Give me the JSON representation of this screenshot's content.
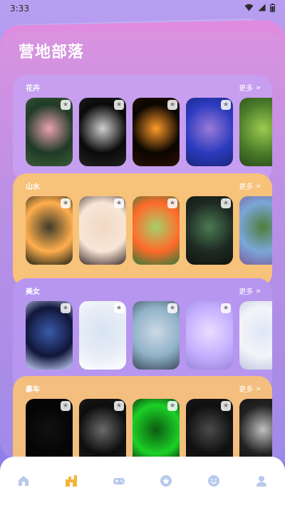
{
  "status_bar": {
    "time": "3:33"
  },
  "page_title": "营地部落",
  "more_label": "更多",
  "more_arrow": "»",
  "sections": [
    {
      "title": "花卉",
      "thumbs": [
        {
          "name": "pink-roses",
          "colors": [
            "#1f3a26",
            "#e9a1b1",
            "#3c5c34"
          ]
        },
        {
          "name": "white-rose",
          "colors": [
            "#0a0a0a",
            "#cfcfcf",
            "#222222"
          ]
        },
        {
          "name": "golden-light",
          "colors": [
            "#0b0501",
            "#ff9a2a",
            "#2a1202"
          ]
        },
        {
          "name": "blue-kaleidoscope",
          "colors": [
            "#2b3bbf",
            "#9b7ad8",
            "#1d257a"
          ]
        },
        {
          "name": "pine-branch",
          "colors": [
            "#4b7c2a",
            "#9ccc4e",
            "#2b4a18"
          ]
        }
      ]
    },
    {
      "title": "山水",
      "thumbs": [
        {
          "name": "sunset-forest",
          "colors": [
            "#ffae4d",
            "#3e3c2a",
            "#1b1f16"
          ]
        },
        {
          "name": "winter-cabin",
          "colors": [
            "#f7e6d6",
            "#f2d8c4",
            "#3f2a2a"
          ]
        },
        {
          "name": "autumn-river",
          "colors": [
            "#ff6a2a",
            "#a7d06b",
            "#2f7c3b"
          ]
        },
        {
          "name": "fern-leaves",
          "colors": [
            "#1e2a23",
            "#4a7a52",
            "#101510"
          ]
        },
        {
          "name": "hills-path",
          "colors": [
            "#7aa6d8",
            "#4f7d3a",
            "#7a5f9c"
          ]
        }
      ]
    },
    {
      "title": "美女",
      "thumbs": [
        {
          "name": "dark-cosplay",
          "colors": [
            "#11163a",
            "#3a5aa8",
            "#c9d6ff"
          ]
        },
        {
          "name": "white-dress",
          "colors": [
            "#e7edf7",
            "#d8e3f2",
            "#ffffff"
          ]
        },
        {
          "name": "beach-girl",
          "colors": [
            "#8fb1c8",
            "#cdd9e6",
            "#3d4a58"
          ]
        },
        {
          "name": "purple-girl",
          "colors": [
            "#c4b0ff",
            "#e8ddff",
            "#9a84d8"
          ]
        },
        {
          "name": "white-cosplay",
          "colors": [
            "#f4f4f8",
            "#dde7f7",
            "#bcc8e0"
          ]
        }
      ]
    },
    {
      "title": "豪车",
      "thumbs": [
        {
          "name": "dark-car",
          "colors": [
            "#050505",
            "#111111",
            "#050505"
          ]
        },
        {
          "name": "silver-car",
          "colors": [
            "#0d0d0d",
            "#6a6a6a",
            "#1e1e1e"
          ]
        },
        {
          "name": "green-car",
          "colors": [
            "#1bd126",
            "#0d5a12",
            "#0c0c0c"
          ]
        },
        {
          "name": "mercedes-car",
          "colors": [
            "#0f0f0f",
            "#4a4a4a",
            "#1a1a1a"
          ]
        },
        {
          "name": "black-car",
          "colors": [
            "#222222",
            "#c0c0c0",
            "#111111"
          ]
        }
      ]
    }
  ],
  "bottom_nav": [
    {
      "icon": "home-icon",
      "active": false
    },
    {
      "icon": "tribe-icon",
      "active": true
    },
    {
      "icon": "gamepad-icon",
      "active": false
    },
    {
      "icon": "star-icon",
      "active": false
    },
    {
      "icon": "smile-icon",
      "active": false
    },
    {
      "icon": "user-icon",
      "active": false
    }
  ],
  "colors": {
    "nav_inactive": "#b7c9ec",
    "nav_active": "#f2b43a"
  }
}
